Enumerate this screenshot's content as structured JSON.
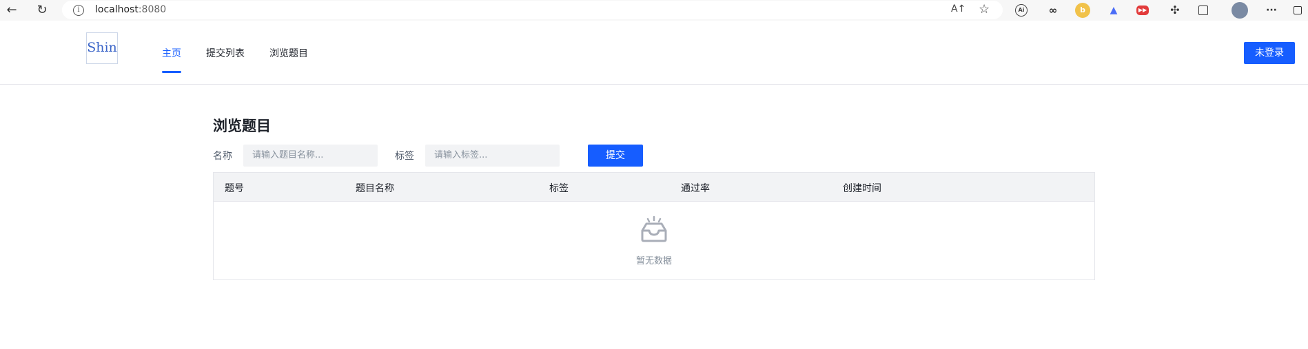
{
  "browser": {
    "url_host": "localhost",
    "url_port": ":8080",
    "back_glyph": "←",
    "reload_glyph": "↻",
    "read_aloud_glyph": "A↑",
    "favorite_glyph": "☆",
    "more_glyph": "···"
  },
  "header": {
    "logo_text": "Shin",
    "menu": [
      {
        "label": "主页"
      },
      {
        "label": "提交列表"
      },
      {
        "label": "浏览题目"
      }
    ],
    "login_label": "未登录",
    "accent_color": "#165dff"
  },
  "main": {
    "title": "浏览题目",
    "filters": {
      "name_label": "名称",
      "name_placeholder": "请输入题目名称...",
      "tag_label": "标签",
      "tag_placeholder": "请输入标签...",
      "submit_label": "提交"
    },
    "table": {
      "columns": [
        "题号",
        "题目名称",
        "标签",
        "通过率",
        "创建时间"
      ],
      "empty_text": "暂无数据"
    }
  }
}
